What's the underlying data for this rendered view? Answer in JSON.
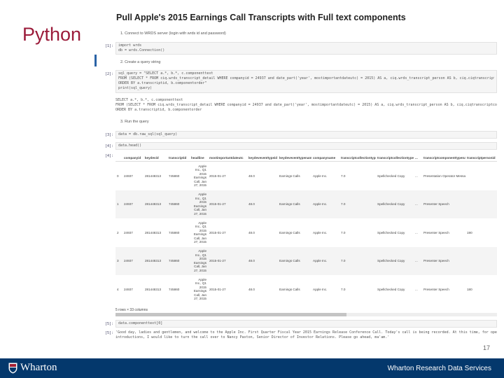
{
  "slide": {
    "title": "Python",
    "page_number": "17"
  },
  "notebook": {
    "title": "Pull Apple's 2015 Earnings Call Transcripts with Full text components",
    "steps": [
      {
        "label": "1. Connect to WRDS server (login with wrds id and password)"
      },
      {
        "label": "2. Create a query string"
      },
      {
        "label": "3. Run the query"
      }
    ],
    "cells": [
      {
        "prompt": "[1]:",
        "lines": [
          "import wrds",
          "db = wrds.Connection()"
        ]
      },
      {
        "prompt": "[2]:",
        "lines": [
          "sql_query = \"SELECT a.*, b.*, c.componenttext",
          "FROM (SELECT * FROM ciq.wrds_transcript_detail WHERE companyid = 24937 and date_part('year', mostimportantdateutc) = 2015) AS a, ciq.wrds_transcript_person AS b, ciq.ciqtranscriptcomponent AS c WHERE a.t",
          "ORDER BY a.transcriptid, b.componentorder\"",
          "print(sql_query)"
        ]
      },
      {
        "prompt": "[3]:",
        "lines": [
          "data = db.raw_sql(sql_query)"
        ]
      },
      {
        "prompt": "[4]:",
        "lines": [
          "data.head()"
        ]
      },
      {
        "prompt": "[5]:",
        "lines": [
          "data.componenttext[0]"
        ]
      }
    ],
    "printed_query": [
      "SELECT a.*, b.*, c.componenttext",
      "FROM (SELECT * FROM ciq.wrds_transcript_detail WHERE companyid = 24937 and date_part('year', mostimportantdateutc) = 2015) AS a, ciq.wrds_transcript_person AS b, ciq.ciqtranscriptcomponent AS c WHERE a.transcri",
      "ORDER BY a.transcriptid, b.componentorder"
    ],
    "output_prompt": "[4]:",
    "table": {
      "columns": [
        "",
        "companyid",
        "keydevid",
        "transcriptid",
        "headline",
        "mostimportantdateutc",
        "keydeveventtypeid",
        "keydeveventtypename",
        "companyname",
        "transcriptcollectiontypeid",
        "transcriptcollectiontypename",
        "...",
        "transcriptcomponenttypename",
        "transcriptpersonid"
      ],
      "rows": [
        {
          "idx": "0",
          "companyid": "24937",
          "keydevid": "281448313",
          "transcriptid": "745860",
          "headline": [
            "Apple",
            "Inc., Q1",
            "2015",
            "Earnings",
            "Call, Jan",
            "27, 2015"
          ],
          "date": "2015-01-27",
          "typeid": "48.0",
          "typename": "Earnings Calls",
          "companyname": "Apple Inc.",
          "collid": "7.0",
          "collname": "Spellchecked Copy",
          "ellipsis": "...",
          "compname": "Presentation Operator Message",
          "personid": ""
        },
        {
          "idx": "1",
          "companyid": "24937",
          "keydevid": "281448313",
          "transcriptid": "745860",
          "headline": [
            "Apple",
            "Inc., Q1",
            "2015",
            "Earnings",
            "Call, Jan",
            "27, 2015"
          ],
          "date": "2015-01-27",
          "typeid": "48.0",
          "typename": "Earnings Calls",
          "companyname": "Apple Inc.",
          "collid": "7.0",
          "collname": "Spellchecked Copy",
          "ellipsis": "...",
          "compname": "Presenter Speech",
          "personid": ""
        },
        {
          "idx": "2",
          "companyid": "24937",
          "keydevid": "281448313",
          "transcriptid": "745860",
          "headline": [
            "Apple",
            "Inc., Q1",
            "2015",
            "Earnings",
            "Call, Jan",
            "27, 2015"
          ],
          "date": "2015-01-27",
          "typeid": "48.0",
          "typename": "Earnings Calls",
          "companyname": "Apple Inc.",
          "collid": "7.0",
          "collname": "Spellchecked Copy",
          "ellipsis": "...",
          "compname": "Presenter Speech",
          "personid": "190"
        },
        {
          "idx": "3",
          "companyid": "24937",
          "keydevid": "281448313",
          "transcriptid": "745860",
          "headline": [
            "Apple",
            "Inc., Q1",
            "2015",
            "Earnings",
            "Call, Jan",
            "27, 2015"
          ],
          "date": "2015-01-27",
          "typeid": "48.0",
          "typename": "Earnings Calls",
          "companyname": "Apple Inc.",
          "collid": "7.0",
          "collname": "Spellchecked Copy",
          "ellipsis": "...",
          "compname": "Presenter Speech",
          "personid": ""
        },
        {
          "idx": "4",
          "companyid": "24937",
          "keydevid": "281448313",
          "transcriptid": "745860",
          "headline": [
            "Apple",
            "Inc., Q1",
            "2015",
            "Earnings",
            "Call, Jan",
            "27, 2015"
          ],
          "date": "2015-01-27",
          "typeid": "48.0",
          "typename": "Earnings Calls",
          "companyname": "Apple Inc.",
          "collid": "7.0",
          "collname": "Spellchecked Copy",
          "ellipsis": "...",
          "compname": "Presenter Speech",
          "personid": "180"
        }
      ],
      "row_count": "5 rows × 33 columns"
    },
    "final_output_prompt": "[5]:",
    "final_output": [
      "'Good day, ladies and gentlemen, and welcome to the Apple Inc. First Quarter Fiscal Year 2015 Earnings Release Conference Call. Today's call is being recorded. At this time, for opening remarks an",
      "introductions, I would like to turn the call over to Nancy Paxton, Senior Director of Investor Relations. Please go ahead, ma'am.'"
    ]
  },
  "footer": {
    "brand": "Wharton",
    "org": "Wharton Research Data Services",
    "background": "#04386c"
  }
}
